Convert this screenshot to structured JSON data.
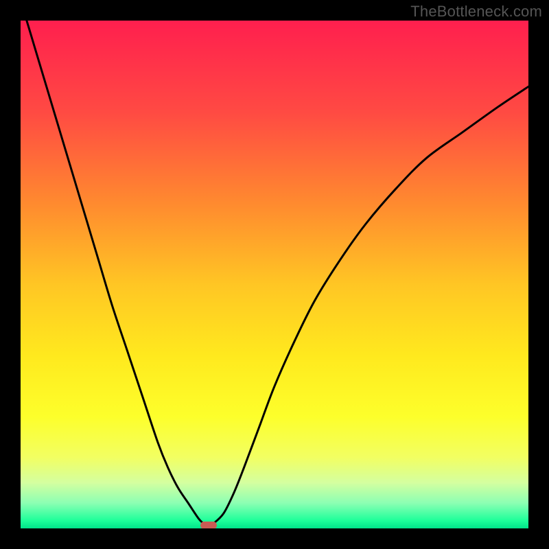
{
  "watermark": "TheBottleneck.com",
  "chart_data": {
    "type": "line",
    "title": "",
    "xlabel": "",
    "ylabel": "",
    "xlim": [
      0,
      100
    ],
    "ylim": [
      0,
      100
    ],
    "series": [
      {
        "name": "curve",
        "x": [
          0,
          3,
          6,
          9,
          12,
          15,
          18,
          21,
          24,
          27,
          29,
          31,
          33,
          35,
          36,
          37,
          38,
          40,
          42,
          44,
          47,
          50,
          54,
          58,
          63,
          68,
          74,
          80,
          87,
          94,
          100
        ],
        "y": [
          104,
          94,
          84,
          74,
          64,
          54,
          44,
          35,
          26,
          17,
          12,
          8,
          5,
          2,
          1,
          0.6,
          1,
          3,
          7,
          12,
          20,
          28,
          37,
          45,
          53,
          60,
          67,
          73,
          78,
          83,
          87
        ]
      }
    ],
    "gradient_stops": [
      {
        "offset": 0.0,
        "color": "#ff1f4e"
      },
      {
        "offset": 0.18,
        "color": "#ff4a43"
      },
      {
        "offset": 0.36,
        "color": "#ff8a2f"
      },
      {
        "offset": 0.52,
        "color": "#ffc624"
      },
      {
        "offset": 0.66,
        "color": "#ffe91e"
      },
      {
        "offset": 0.78,
        "color": "#fdff2b"
      },
      {
        "offset": 0.86,
        "color": "#f2ff62"
      },
      {
        "offset": 0.91,
        "color": "#d4ffa0"
      },
      {
        "offset": 0.95,
        "color": "#8cffb3"
      },
      {
        "offset": 0.985,
        "color": "#1cff9a"
      },
      {
        "offset": 1.0,
        "color": "#00e38a"
      }
    ],
    "min_marker": {
      "x": 37,
      "y": 0.6,
      "color": "#c95b54"
    }
  }
}
